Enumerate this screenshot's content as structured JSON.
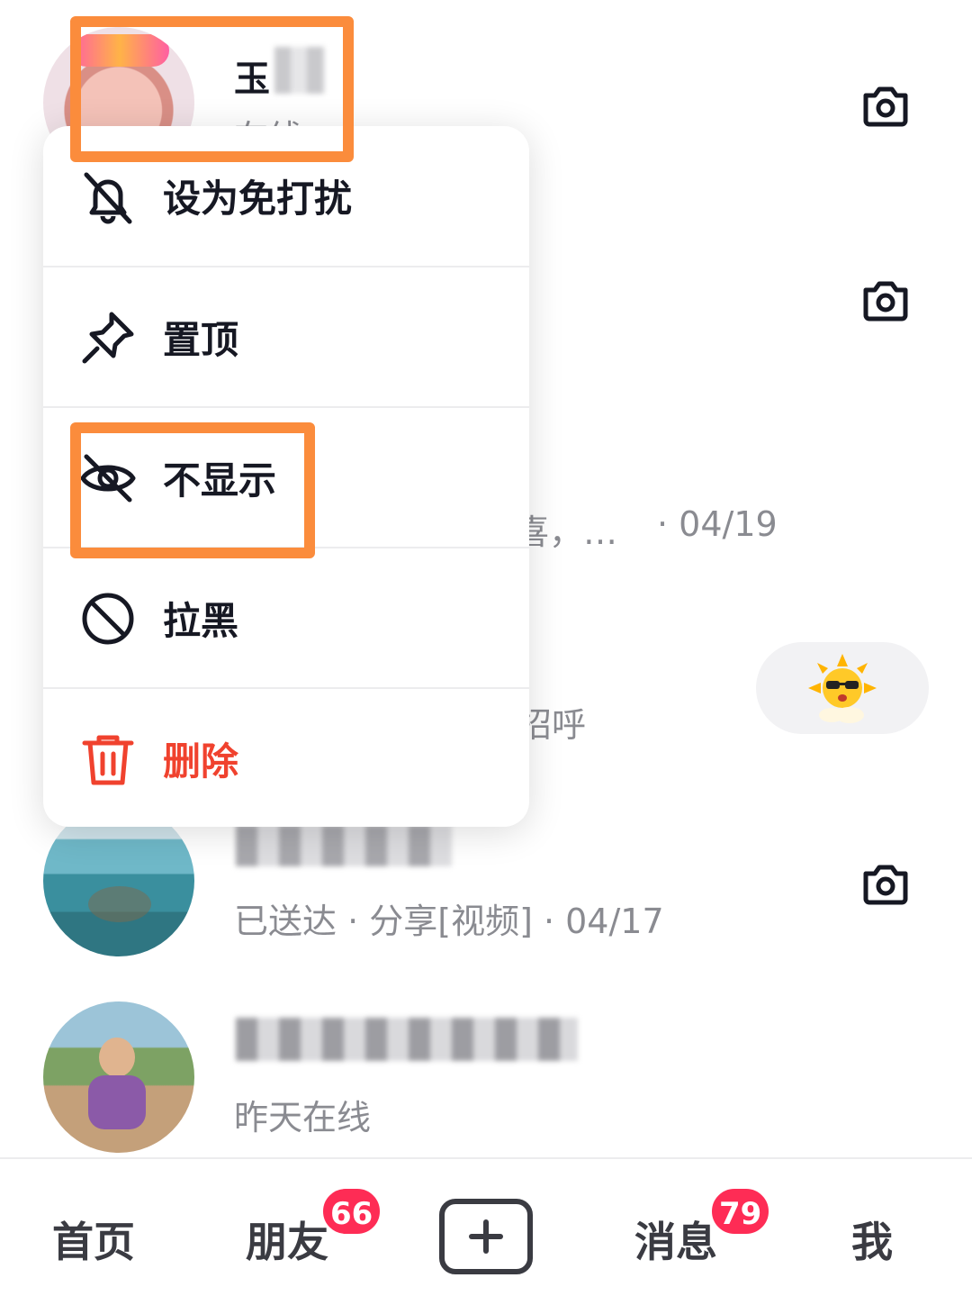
{
  "conversations": [
    {
      "name": "玉",
      "status": "在线",
      "trailing": "camera-icon"
    },
    {
      "name": "",
      "status": "",
      "trailing": "camera-icon"
    },
    {
      "name": "",
      "status_fragment": "喜，…",
      "date": "· 04/19"
    },
    {
      "name": "",
      "status_fragment": "招呼",
      "trailing": "sun-sunglasses-emoji"
    },
    {
      "name": "",
      "status": "已送达 · 分享[视频] · 04/17",
      "trailing": "camera-icon"
    },
    {
      "name": "",
      "status": "昨天在线"
    }
  ],
  "context_menu": {
    "items": [
      {
        "label": "设为免打扰",
        "icon": "bell-off-icon"
      },
      {
        "label": "置顶",
        "icon": "pin-icon"
      },
      {
        "label": "不显示",
        "icon": "eye-off-icon"
      },
      {
        "label": "拉黑",
        "icon": "block-icon"
      },
      {
        "label": "删除",
        "icon": "trash-icon",
        "danger": true
      }
    ]
  },
  "bottom_nav": {
    "home": "首页",
    "friends": "朋友",
    "friends_badge": "66",
    "messages": "消息",
    "messages_badge": "79",
    "me": "我"
  },
  "colors": {
    "highlight": "#fb8c3c",
    "danger": "#f0422e",
    "badge": "#fe2c55",
    "secondary_text": "#8a8b91"
  }
}
